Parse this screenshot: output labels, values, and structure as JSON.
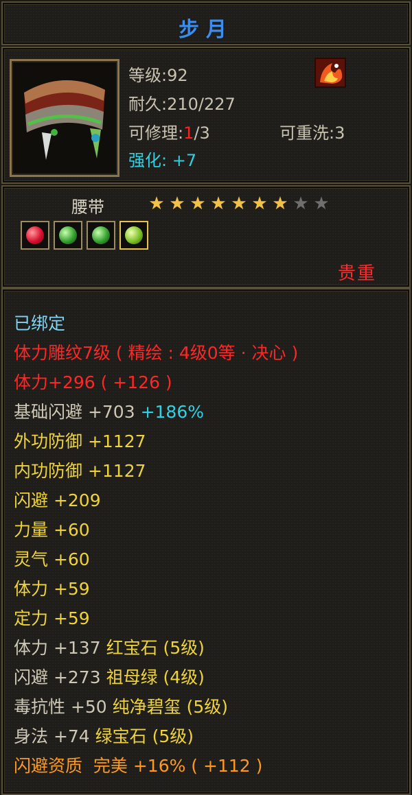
{
  "item": {
    "name": "步月",
    "level_line": "等级:92",
    "durability_line": "耐久:210/227",
    "repair_label": "可修理:",
    "repair_used": "1",
    "repair_total": "/3",
    "rewash_line": "可重洗:3",
    "enhance_label": "强化: ",
    "enhance_value": "+7",
    "type": "腰带",
    "quality": "贵重",
    "stars_total": 9,
    "stars_filled": 7,
    "gems": [
      "red-gem-icon",
      "green-gem-icon",
      "green-gem-icon",
      "lime-gem-icon"
    ]
  },
  "stats": {
    "bound": "已绑定",
    "engrave": "体力雕纹7级 ( 精绘 : 4级0等 · 决心 )",
    "stamina_main": "体力+296 ( +126 )",
    "base_dodge_label": "基础闪避 +703",
    "base_dodge_pct": "+186%",
    "ext_def": "外功防御 +1127",
    "int_def": "内功防御 +1127",
    "dodge": "闪避 +209",
    "strength": "力量 +60",
    "spirit": "灵气 +60",
    "stamina": "体力 +59",
    "focus": "定力 +59",
    "gem1_stat": "体力 +137",
    "gem1_name": "红宝石 (5级)",
    "gem2_stat": "闪避 +273",
    "gem2_name": "祖母绿 (4级)",
    "gem3_stat": "毒抗性 +50",
    "gem3_name": "纯净碧玺 (5级)",
    "gem4_stat": "身法 +74",
    "gem4_name": "绿宝石 (5级)",
    "aptitude": "闪避资质  完美 +16% ( +112 )"
  },
  "colors": {
    "title": "#3d8eea",
    "red": "#ff2626",
    "cyan": "#2ed2e6",
    "yellow": "#efd33a",
    "orange": "#ff9a1e"
  }
}
